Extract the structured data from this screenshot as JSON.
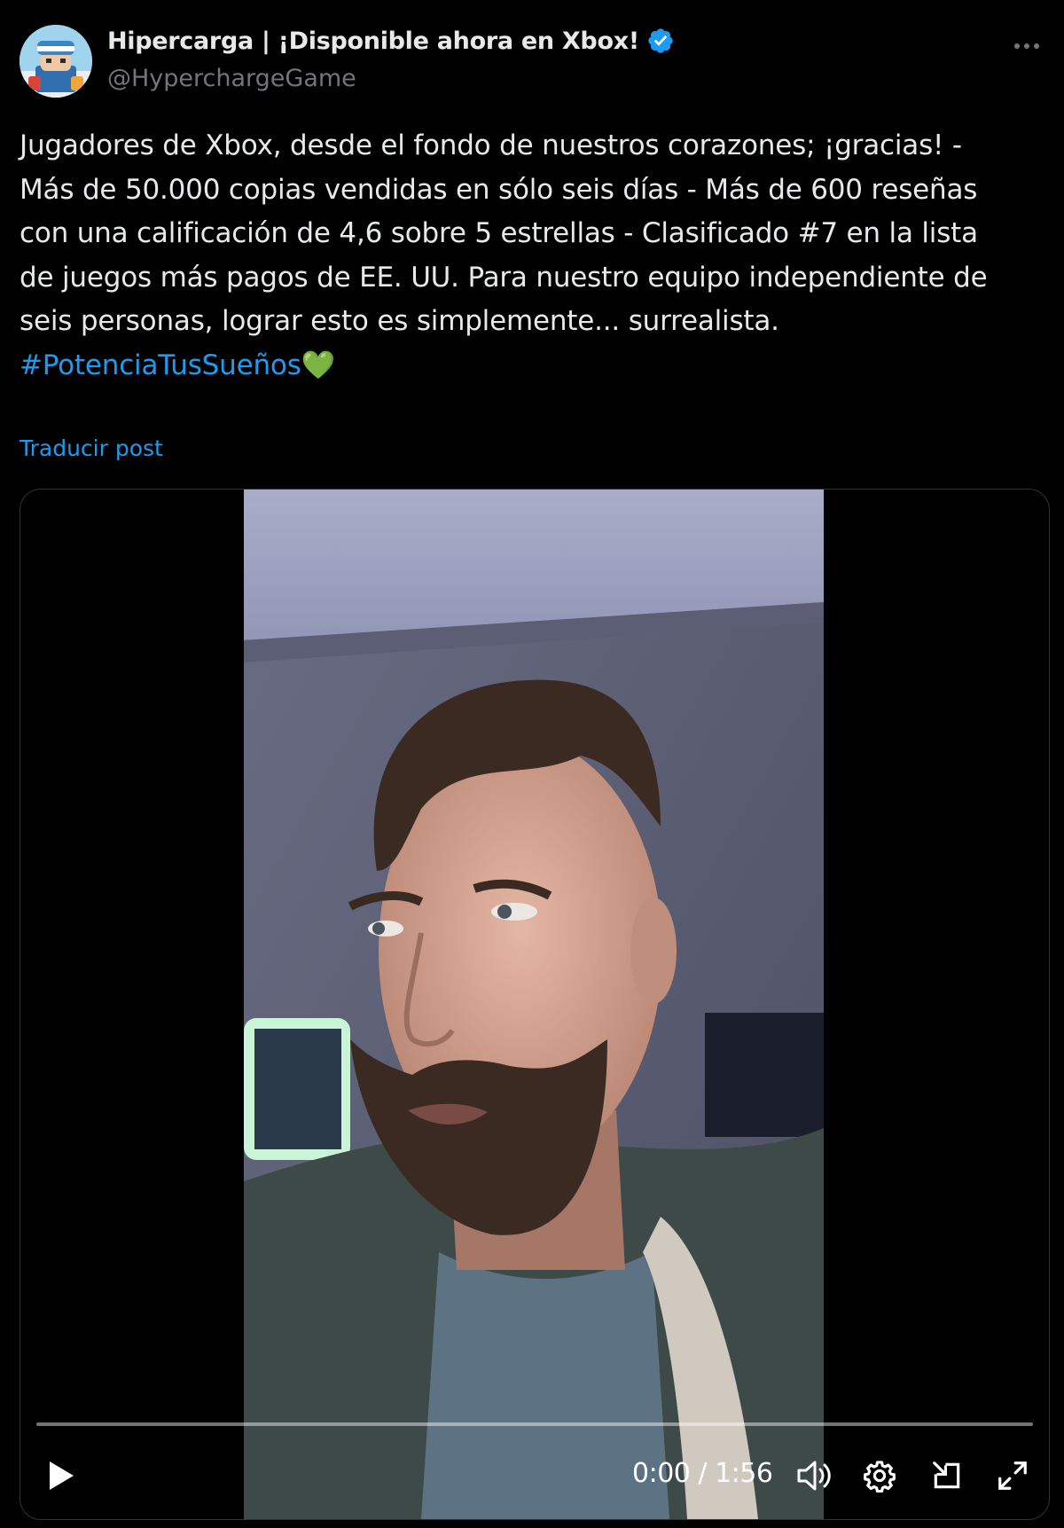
{
  "author": {
    "display_name": "Hipercarga | ¡Disponible ahora en Xbox!",
    "handle": "@HyperchargeGame",
    "verified": true,
    "avatar_icon": "game-character-avatar"
  },
  "post": {
    "lines": [
      "Jugadores de Xbox, desde el fondo de nuestros corazones; ¡gracias! -",
      "Más de 50.000 copias vendidas en sólo seis días - Más de 600 reseñas",
      "con una calificación de 4,6 sobre 5 estrellas - Clasificado #7 en la lista",
      "de juegos más pagos de EE. UU. Para nuestro equipo independiente de",
      "seis personas, lograr esto es simplemente... surrealista."
    ],
    "hashtag": "#PotenciaTusSueños",
    "emoji": "💚",
    "translate_label": "Traducir post"
  },
  "more_menu_icon": "ellipsis-icon",
  "video": {
    "current_time": "0:00",
    "separator": " / ",
    "duration": "1:56",
    "progress": 0,
    "controls": {
      "play_icon": "play-icon",
      "volume_icon": "volume-icon",
      "settings_icon": "gear-icon",
      "pip_icon": "picture-in-picture-icon",
      "fullscreen_icon": "fullscreen-icon"
    }
  },
  "colors": {
    "background": "#000000",
    "text": "#e7e9ea",
    "muted": "#71767b",
    "link": "#1d9bf0",
    "verified": "#1d9bf0",
    "heart": "#5fbf4f"
  }
}
